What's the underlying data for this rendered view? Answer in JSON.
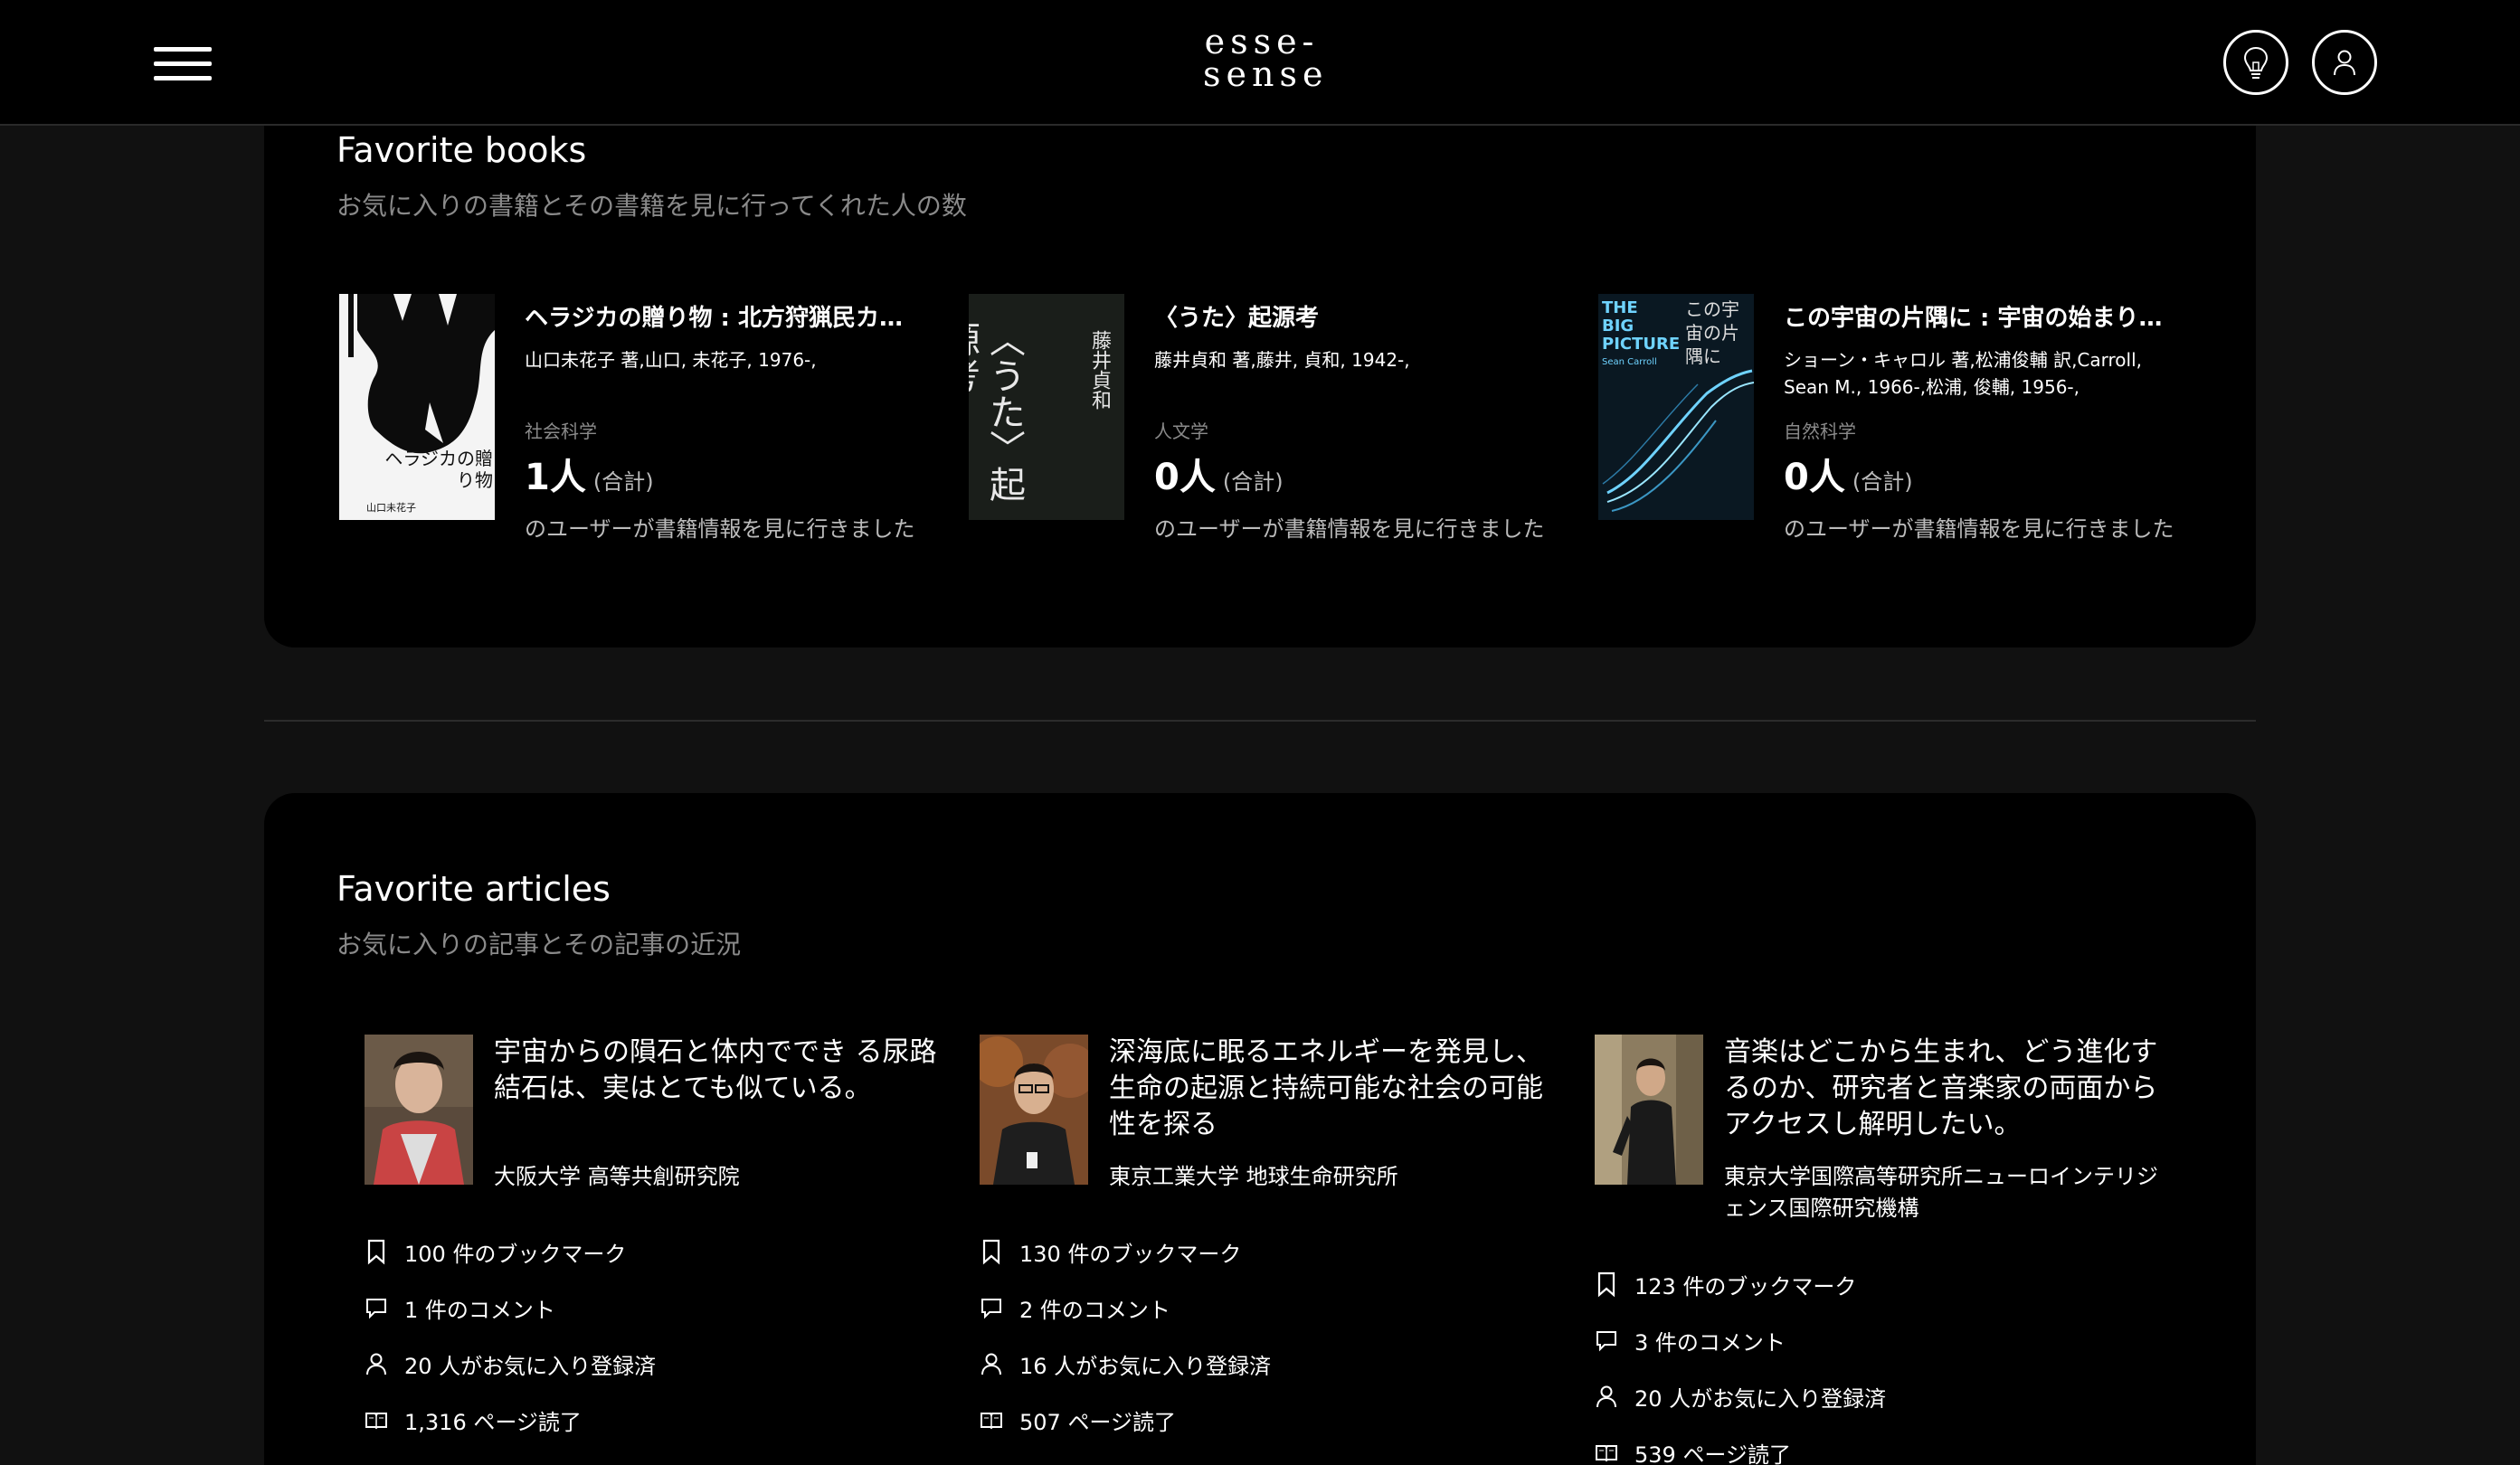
{
  "header": {
    "logo_line1": "esse-",
    "logo_line2": "sense",
    "menu_icon": "hamburger-menu-icon",
    "idea_icon": "lightbulb-icon",
    "user_icon": "user-icon"
  },
  "books": {
    "title": "Favorite books",
    "subtitle": "お気に入りの書籍とその書籍を見に行ってくれた人の数",
    "items": [
      {
        "title": "ヘラジカの贈り物 : 北方狩猟民カ…",
        "author": "山口未花子 著,山口, 未花子, 1976-,",
        "genre": "社会科学",
        "count": "1人",
        "total_label": "(合計)",
        "note": "のユーザーが書籍情報を見に行きました",
        "cover_text": "ヘラジカの贈り物",
        "cover_author": "山口未花子"
      },
      {
        "title": "〈うた〉起源考",
        "author": "藤井貞和 著,藤井, 貞和, 1942-,",
        "genre": "人文学",
        "count": "0人",
        "total_label": "(合計)",
        "note": "のユーザーが書籍情報を見に行きました",
        "cover_text": "〈うた〉起源考",
        "cover_author": "藤井貞和"
      },
      {
        "title": "この宇宙の片隅に : 宇宙の始まり…",
        "author": "ショーン・キャロル 著,松浦俊輔 訳,Carroll, Sean M., 1966-,松浦, 俊輔, 1956-,",
        "genre": "自然科学",
        "count": "0人",
        "total_label": "(合計)",
        "note": "のユーザーが書籍情報を見に行きました",
        "cover_text": "THE BIG PICTURE",
        "cover_author": "Sean Carroll",
        "cover_jp": "この宇宙の片隅に"
      }
    ]
  },
  "articles": {
    "title": "Favorite articles",
    "subtitle": "お気に入りの記事とその記事の近況",
    "items": [
      {
        "title": "宇宙からの隕石と体内ででき る尿路結石は、実はとても似ている。",
        "institution": "大阪大学 高等共創研究院",
        "bookmarks": "100 件のブックマーク",
        "comments": "1 件のコメント",
        "favorites": "20 人がお気に入り登録済",
        "pages": "1,316 ページ読了"
      },
      {
        "title": "深海底に眠るエネルギーを発見し、生命の起源と持続可能な社会の可能性を探る",
        "institution": "東京工業大学 地球生命研究所",
        "bookmarks": "130 件のブックマーク",
        "comments": "2 件のコメント",
        "favorites": "16 人がお気に入り登録済",
        "pages": "507 ページ読了"
      },
      {
        "title": "音楽はどこから生まれ、どう進化するのか、研究者と音楽家の両面からアクセスし解明したい。",
        "institution": "東京大学国際高等研究所ニューロインテリジェンス国際研究機構",
        "bookmarks": "123 件のブックマーク",
        "comments": "3 件のコメント",
        "favorites": "20 人がお気に入り登録済",
        "pages": "539 ページ読了"
      }
    ]
  }
}
